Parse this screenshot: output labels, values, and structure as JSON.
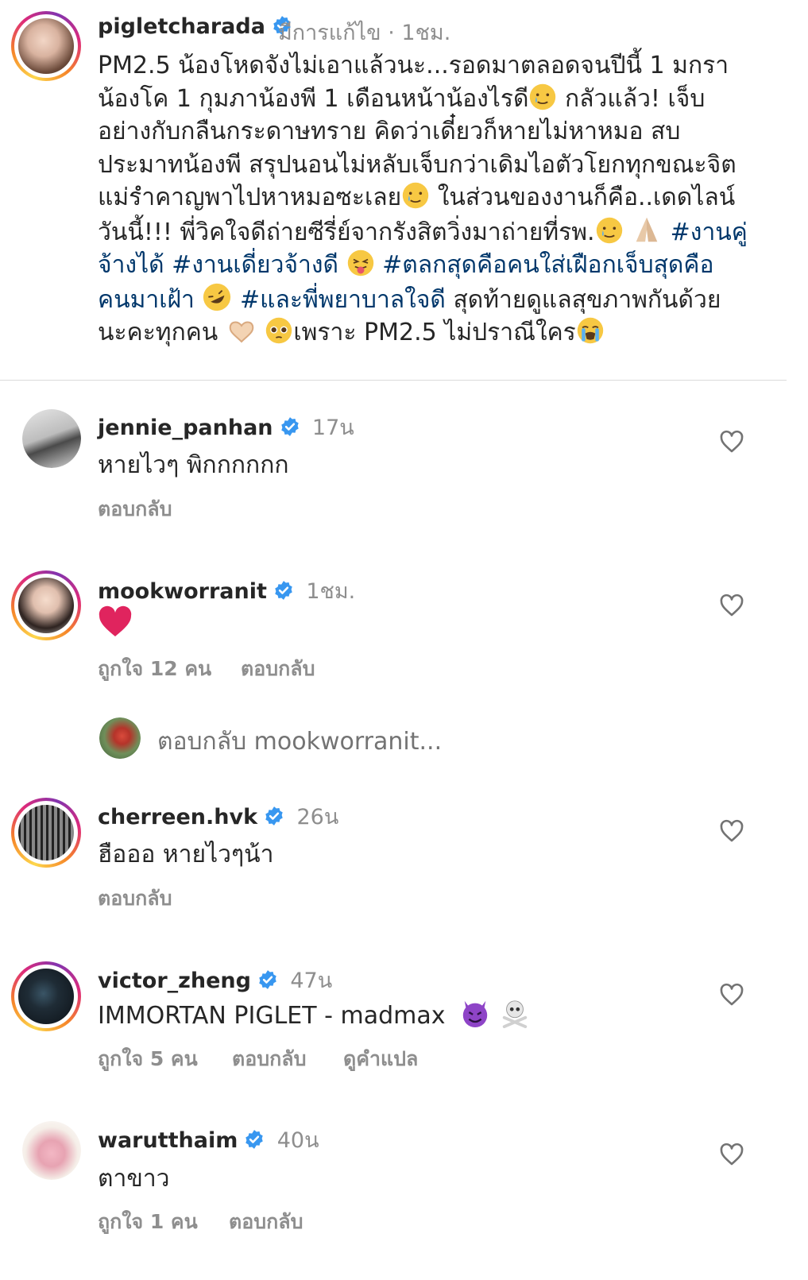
{
  "post": {
    "username": "pigletcharada",
    "edited": "มีการแก้ไข",
    "separator": "·",
    "time": "1ชม.",
    "caption_part1": "PM2.5 น้องโหดจังไม่เอาแล้วนะ...รอดมาตลอดจนปีนี้ 1 มกรา\nน้องโค 1 กุมภาน้องพี 1 เดือนหน้าน้องไรดี",
    "caption_part2": " กลัวแล้ว! เจ็บ\nอย่างกับกลืนกระดาษทราย คิดว่าเดี๋ยวก็หายไม่หาหมอ สบ\nประมาทน้องพี สรุปนอนไม่หลับเจ็บกว่าเดิมไอตัวโยกทุกขณะจิต\nแม่รำคาญพาไปหาหมอซะเลย",
    "caption_part3": " ในส่วนของงานก็คือ..เดดไลน์\nวันนี้!!! พี่วิคใจดีถ่ายซีรี่ย์จากรังสิตวิ่งมาถ่ายที่รพ.",
    "hashtag1": "#งานคู่\nจ้างได้ #งานเดี่ยวจ้างดี",
    "hashtag2": "#ตลกสุดคือคนใส่เฝือกเจ็บสุดคือ\nคนมาเฝ้า",
    "hashtag3": "#และพี่พยาบาลใจดี",
    "caption_part4": " สุดท้ายดูแลสุขภาพกันด้วย\nนะคะทุกคน ",
    "caption_part5": "เพราะ PM2.5 ไม่ปราณีใคร"
  },
  "comments": [
    {
      "username": "jennie_panhan",
      "time": "17น",
      "text": "หายไวๆ พิกกกกกก",
      "reply": "ตอบกลับ"
    },
    {
      "username": "mookworranit",
      "time": "1ชม.",
      "text": "",
      "likes": "ถูกใจ 12 คน",
      "reply": "ตอบกลับ"
    },
    {
      "username": "cherreen.hvk",
      "time": "26น",
      "text": "ฮือออ หายไวๆน้า",
      "reply": "ตอบกลับ"
    },
    {
      "username": "victor_zheng",
      "time": "47น",
      "text": "IMMORTAN PIGLET - madmax",
      "likes": "ถูกใจ 5 คน",
      "reply": "ตอบกลับ",
      "translate": "ดูคำแปล"
    },
    {
      "username": "warutthaim",
      "time": "40น",
      "text": "ตาขาว",
      "likes": "ถูกใจ 1 คน",
      "reply": "ตอบกลับ"
    }
  ],
  "reply_input": {
    "placeholder": "ตอบกลับ mookworranit..."
  },
  "colors": {
    "verified": "#3897f0",
    "hashtag": "#00376b",
    "muted": "#8e8e8e",
    "heart_emoji": "#e0245e"
  },
  "icons": [
    "verified-badge-icon",
    "heart-outline-icon",
    "cry-smile-emoji",
    "pray-emoji",
    "tongue-wink-emoji",
    "rofl-emoji",
    "heart-hands-emoji",
    "pleading-emoji",
    "loud-cry-emoji",
    "red-heart-emoji",
    "devil-emoji",
    "skull-crossbones-emoji"
  ]
}
